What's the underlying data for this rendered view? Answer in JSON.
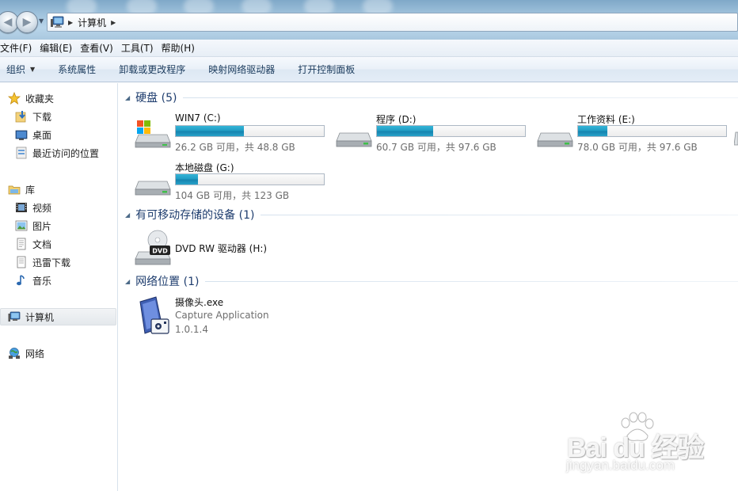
{
  "address_bar": {
    "crumbs": [
      "计算机"
    ],
    "back_icon": "back-arrow-icon",
    "forward_icon": "forward-arrow-icon"
  },
  "menu": {
    "items": [
      "文件(F)",
      "编辑(E)",
      "查看(V)",
      "工具(T)",
      "帮助(H)"
    ]
  },
  "command_bar": {
    "organize": "组织",
    "items": [
      "系统属性",
      "卸载或更改程序",
      "映射网络驱动器",
      "打开控制面板"
    ]
  },
  "nav_pane": {
    "favorites": {
      "label": "收藏夹",
      "icon": "star-icon",
      "items": [
        {
          "label": "下载",
          "icon": "download-folder-icon"
        },
        {
          "label": "桌面",
          "icon": "desktop-icon"
        },
        {
          "label": "最近访问的位置",
          "icon": "recent-places-icon"
        }
      ]
    },
    "libraries": {
      "label": "库",
      "icon": "library-icon",
      "items": [
        {
          "label": "视频",
          "icon": "video-icon"
        },
        {
          "label": "图片",
          "icon": "pictures-icon"
        },
        {
          "label": "文档",
          "icon": "documents-icon"
        },
        {
          "label": "迅雷下载",
          "icon": "xunlei-download-icon"
        },
        {
          "label": "音乐",
          "icon": "music-icon"
        }
      ]
    },
    "computer": {
      "label": "计算机",
      "icon": "computer-icon"
    },
    "network": {
      "label": "网络",
      "icon": "network-icon"
    }
  },
  "groups": {
    "hard_disks": {
      "title": "硬盘 (5)",
      "drives": [
        {
          "name": "WIN7 (C:)",
          "info": "26.2 GB 可用，共 48.8 GB",
          "used_fraction": 0.46,
          "icon": "windows-drive-icon"
        },
        {
          "name": "程序 (D:)",
          "info": "60.7 GB 可用，共 97.6 GB",
          "used_fraction": 0.38,
          "icon": "hard-drive-icon"
        },
        {
          "name": "工作资料 (E:)",
          "info": "78.0 GB 可用，共 97.6 GB",
          "used_fraction": 0.2,
          "icon": "hard-drive-icon"
        },
        {
          "name": "本地磁盘 (G:)",
          "info": "104 GB 可用，共 123 GB",
          "used_fraction": 0.15,
          "icon": "hard-drive-icon"
        }
      ]
    },
    "removable": {
      "title": "有可移动存储的设备 (1)",
      "devices": [
        {
          "name": "DVD RW 驱动器 (H:)",
          "icon": "dvd-drive-icon",
          "icon_label": "DVD"
        }
      ]
    },
    "network_locations": {
      "title": "网络位置 (1)",
      "items": [
        {
          "name": "摄像头.exe",
          "description": "Capture Application",
          "version": "1.0.1.4",
          "icon": "camera-app-icon"
        }
      ]
    }
  },
  "watermark": {
    "logo": "Bai du 经验",
    "url": "jingyan.baidu.com"
  },
  "colors": {
    "capacity_bar": "#1f9ac2",
    "group_header": "#1e3d6e",
    "command_text": "#1a3a5c"
  }
}
